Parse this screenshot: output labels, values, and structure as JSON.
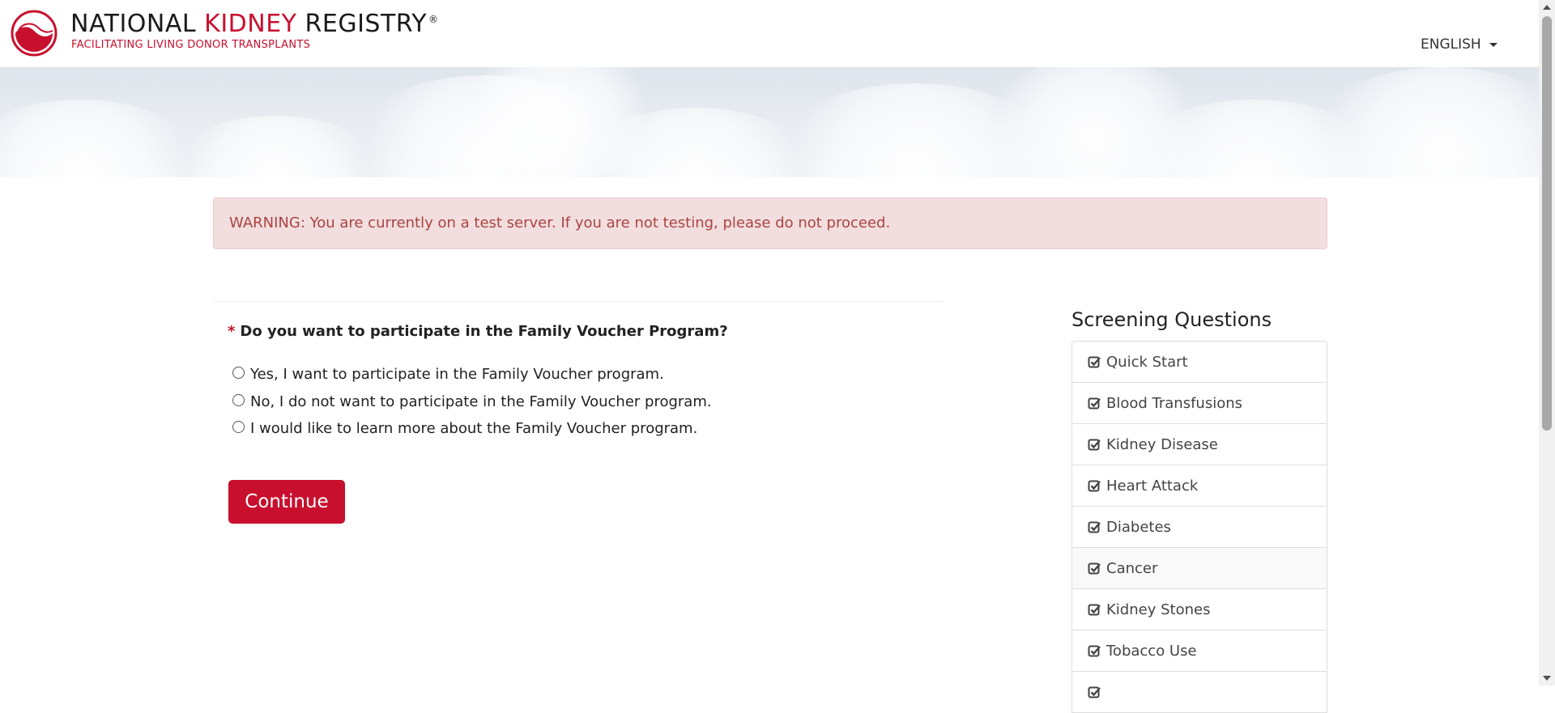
{
  "header": {
    "brand_part1": "NATIONAL ",
    "brand_part2": "KIDNEY",
    "brand_part3": " REGISTRY",
    "registered": "®",
    "tagline": "FACILITATING LIVING DONOR TRANSPLANTS",
    "language": "ENGLISH"
  },
  "warning": {
    "text": "WARNING: You are currently on a test server. If you are not testing, please do not proceed."
  },
  "form": {
    "required_mark": "*",
    "question": "Do you want to participate in the Family Voucher Program?",
    "options": [
      {
        "label": "Yes, I want to participate in the Family Voucher program.",
        "selected": false
      },
      {
        "label": "No, I do not want to participate in the Family Voucher program.",
        "selected": false
      },
      {
        "label": "I would like to learn more about the Family Voucher program.",
        "selected": false
      }
    ],
    "continue_label": "Continue"
  },
  "sidebar": {
    "title": "Screening Questions",
    "items": [
      {
        "label": "Quick Start",
        "icon": "check-square-icon"
      },
      {
        "label": "Blood Transfusions",
        "icon": "check-square-icon"
      },
      {
        "label": "Kidney Disease",
        "icon": "check-square-icon"
      },
      {
        "label": "Heart Attack",
        "icon": "check-square-icon"
      },
      {
        "label": "Diabetes",
        "icon": "check-square-icon"
      },
      {
        "label": "Cancer",
        "icon": "check-square-icon"
      },
      {
        "label": "Kidney Stones",
        "icon": "check-square-icon"
      },
      {
        "label": "Tobacco Use",
        "icon": "check-square-icon"
      }
    ]
  },
  "colors": {
    "brand_red": "#c8102e",
    "warning_bg": "#f2dede",
    "warning_text": "#a94442"
  }
}
